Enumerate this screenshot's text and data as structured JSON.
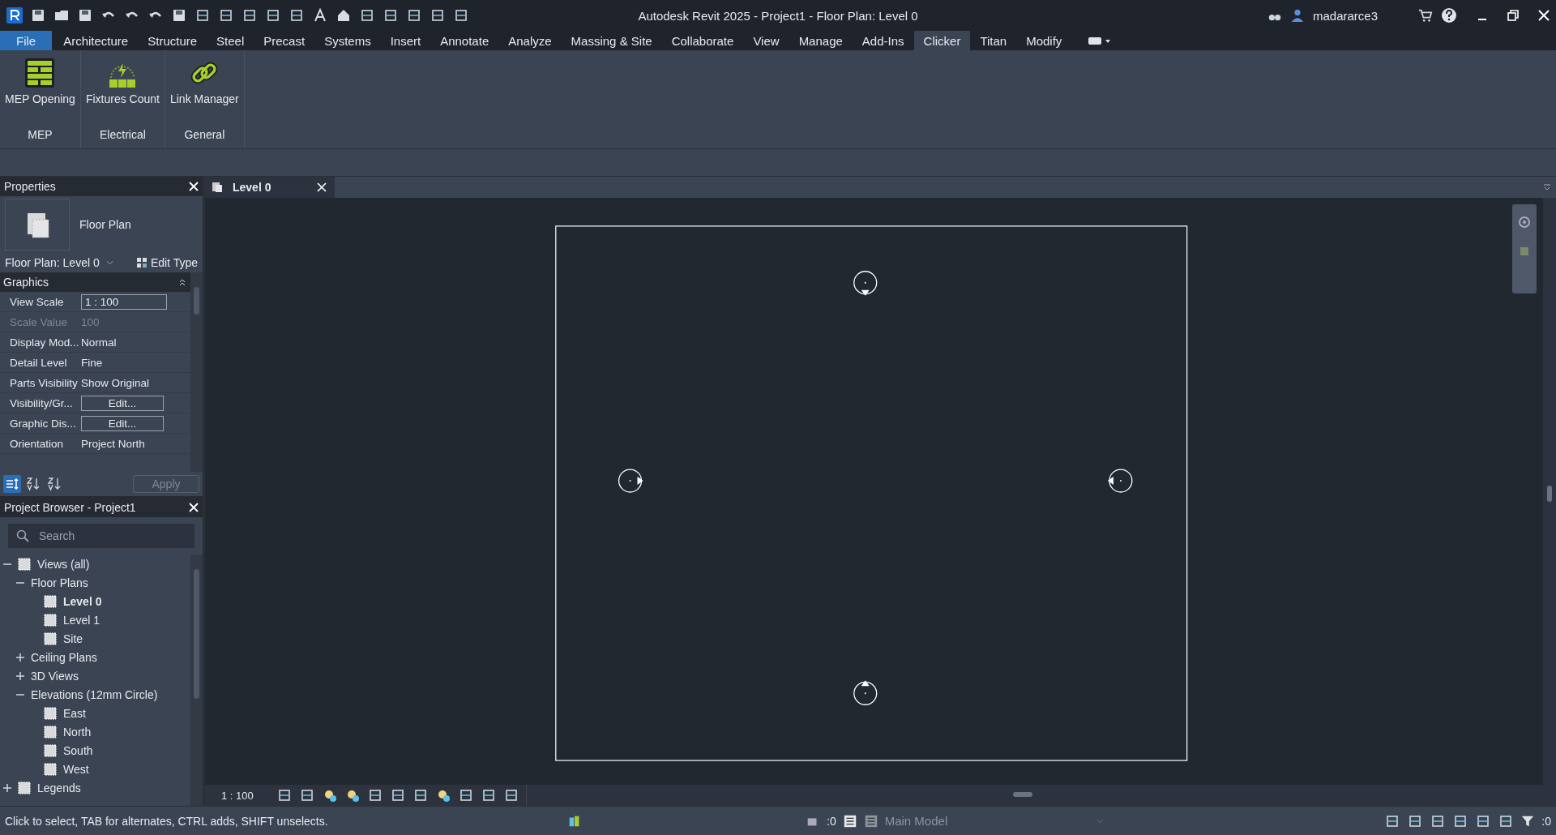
{
  "window": {
    "title": "Autodesk Revit 2025 - Project1 - Floor Plan: Level 0",
    "user": "madararce3"
  },
  "menu_tabs": [
    {
      "label": "File",
      "kind": "file",
      "selected": false
    },
    {
      "label": "Architecture",
      "kind": "tab",
      "selected": false
    },
    {
      "label": "Structure",
      "kind": "tab",
      "selected": false
    },
    {
      "label": "Steel",
      "kind": "tab",
      "selected": false
    },
    {
      "label": "Precast",
      "kind": "tab",
      "selected": false
    },
    {
      "label": "Systems",
      "kind": "tab",
      "selected": false
    },
    {
      "label": "Insert",
      "kind": "tab",
      "selected": false
    },
    {
      "label": "Annotate",
      "kind": "tab",
      "selected": false
    },
    {
      "label": "Analyze",
      "kind": "tab",
      "selected": false
    },
    {
      "label": "Massing & Site",
      "kind": "tab",
      "selected": false
    },
    {
      "label": "Collaborate",
      "kind": "tab",
      "selected": false
    },
    {
      "label": "View",
      "kind": "tab",
      "selected": false
    },
    {
      "label": "Manage",
      "kind": "tab",
      "selected": false
    },
    {
      "label": "Add-Ins",
      "kind": "tab",
      "selected": false
    },
    {
      "label": "Clicker",
      "kind": "tab",
      "selected": true
    },
    {
      "label": "Titan",
      "kind": "tab",
      "selected": false
    },
    {
      "label": "Modify",
      "kind": "tab",
      "selected": false
    }
  ],
  "ribbon_panels": [
    {
      "title": "MEP",
      "buttons": [
        {
          "label": "MEP Opening",
          "kind": "bricks"
        }
      ]
    },
    {
      "title": "Electrical",
      "buttons": [
        {
          "label": "Fixtures Count",
          "kind": "fixtures"
        }
      ]
    },
    {
      "title": "General",
      "buttons": [
        {
          "label": "Link Manager",
          "kind": "link"
        }
      ]
    }
  ],
  "properties": {
    "title": "Properties",
    "type_name": "Floor Plan",
    "instance": "Floor Plan: Level 0",
    "edit_type": "Edit Type",
    "section": "Graphics",
    "rows": [
      {
        "name": "View Scale",
        "value": "1 : 100",
        "kind": "input"
      },
      {
        "name": "Scale Value",
        "value": "100",
        "kind": "readonly"
      },
      {
        "name": "Display Mod...",
        "value": "Normal",
        "kind": "text"
      },
      {
        "name": "Detail Level",
        "value": "Fine",
        "kind": "text"
      },
      {
        "name": "Parts Visibility",
        "value": "Show Original",
        "kind": "text"
      },
      {
        "name": "Visibility/Gr...",
        "value": "Edit...",
        "kind": "button"
      },
      {
        "name": "Graphic Dis...",
        "value": "Edit...",
        "kind": "button"
      },
      {
        "name": "Orientation",
        "value": "Project North",
        "kind": "text"
      }
    ],
    "apply": "Apply"
  },
  "browser": {
    "title": "Project Browser - Project1",
    "search": {
      "placeholder": "Search"
    },
    "tree": [
      {
        "label": "Views (all)",
        "expanded": true,
        "children": [
          {
            "label": "Floor Plans",
            "expanded": true,
            "children": [
              {
                "label": "Level 0",
                "selected": true
              },
              {
                "label": "Level 1",
                "selected": false
              },
              {
                "label": "Site",
                "selected": false
              }
            ]
          },
          {
            "label": "Ceiling Plans",
            "expanded": false
          },
          {
            "label": "3D Views",
            "expanded": false
          },
          {
            "label": "Elevations (12mm Circle)",
            "expanded": true,
            "children": [
              {
                "label": "East",
                "selected": false
              },
              {
                "label": "North",
                "selected": false
              },
              {
                "label": "South",
                "selected": false
              },
              {
                "label": "West",
                "selected": false
              }
            ]
          }
        ]
      },
      {
        "label": "Legends",
        "expanded": false
      }
    ]
  },
  "view_tab": {
    "label": "Level 0"
  },
  "view_control": {
    "scale": "1 : 100"
  },
  "status_bar": {
    "message": "Click to select, TAB for alternates, CTRL adds, SHIFT unselects.",
    "worksharing_count": ":0",
    "model": "Main Model",
    "filter_count": ":0"
  }
}
